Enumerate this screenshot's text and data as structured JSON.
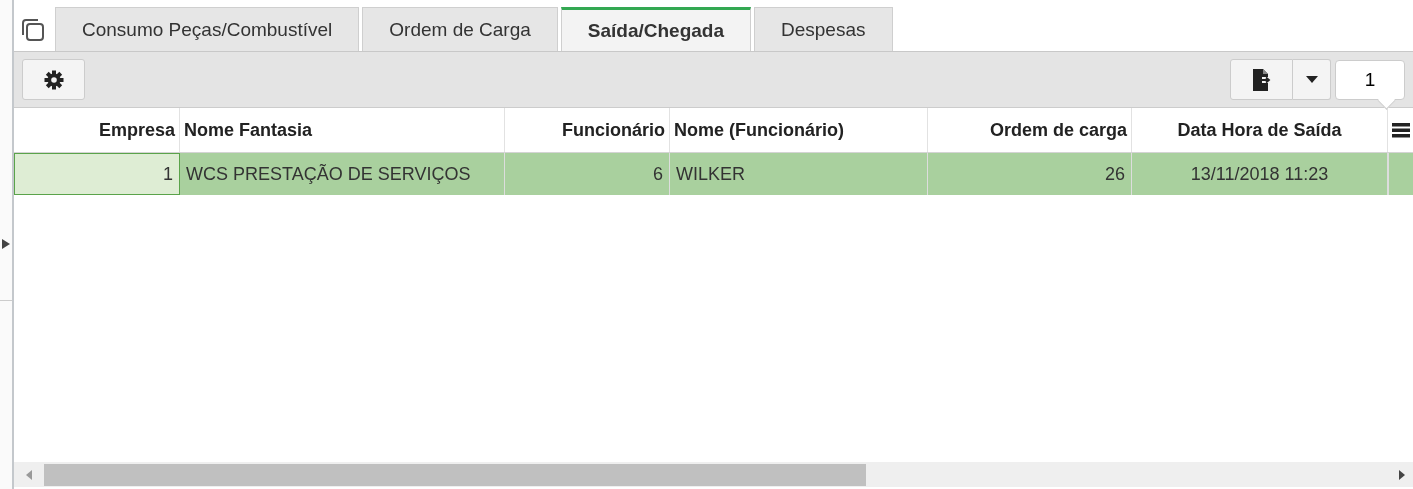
{
  "tabs": [
    {
      "label": "Consumo Peças/Combustível",
      "selected": false
    },
    {
      "label": "Ordem de Carga",
      "selected": false
    },
    {
      "label": "Saída/Chegada",
      "selected": true
    },
    {
      "label": "Despesas",
      "selected": false
    }
  ],
  "pager": {
    "value": "1"
  },
  "table": {
    "columns": [
      "Empresa",
      "Nome Fantasia",
      "Funcionário",
      "Nome (Funcionário)",
      "Ordem de carga",
      "Data Hora de Saída"
    ],
    "rows": [
      {
        "selected": true,
        "cells": [
          {
            "text": "1",
            "focused": true
          },
          {
            "text": "WCS PRESTAÇÃO DE SERVIÇOS",
            "focused": false
          },
          {
            "text": "6",
            "focused": false
          },
          {
            "text": "WILKER",
            "focused": false
          },
          {
            "text": "26",
            "focused": false
          },
          {
            "text": "13/11/2018 11:23",
            "focused": false
          }
        ]
      }
    ]
  }
}
